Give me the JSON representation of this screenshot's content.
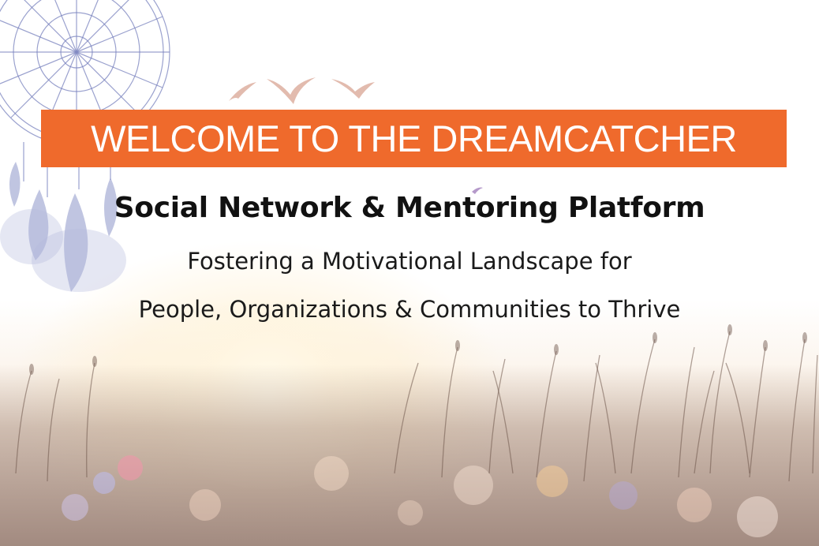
{
  "banner": {
    "title": "WELCOME TO THE DREAMCATCHER",
    "color": "#ef6a2c"
  },
  "headline": "Social Network & Mentoring Platform",
  "subtitle_line1": "Fostering a Motivational Landscape for",
  "subtitle_line2": "People, Organizations & Communities to Thrive",
  "icons": [
    "dreamcatcher-icon",
    "birds-icon",
    "feather-icon"
  ]
}
